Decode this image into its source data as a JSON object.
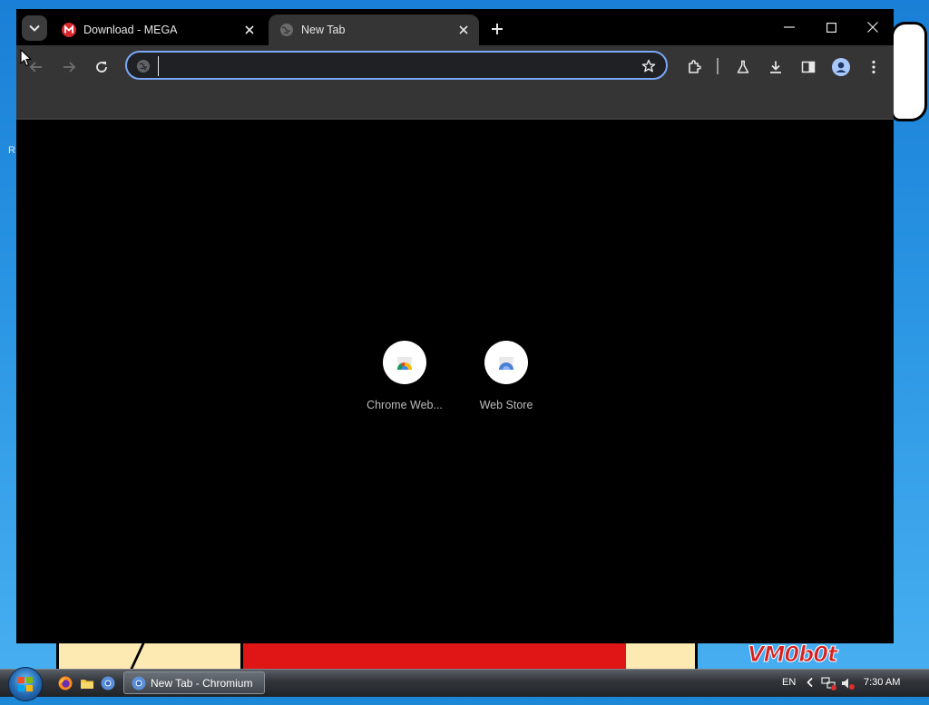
{
  "desktop": {
    "corner_letter": "R",
    "wallpaper_text": "VM0b0t"
  },
  "browser": {
    "tabs": [
      {
        "title": "Download - MEGA",
        "favicon": "mega-icon",
        "active": false
      },
      {
        "title": "New Tab",
        "favicon": "globe-icon",
        "active": true
      }
    ],
    "omnibox": {
      "value": "",
      "placeholder": ""
    },
    "shortcuts": [
      {
        "label": "Chrome Web...",
        "icon": "chrome-web-store-icon"
      },
      {
        "label": "Web Store",
        "icon": "web-store-icon"
      }
    ]
  },
  "taskbar": {
    "task_label": "New Tab - Chromium",
    "language": "EN",
    "clock": "7:30 AM"
  },
  "colors": {
    "accent": "#7aa7f7",
    "toolbar": "#353535",
    "mega_red": "#d9272e"
  }
}
